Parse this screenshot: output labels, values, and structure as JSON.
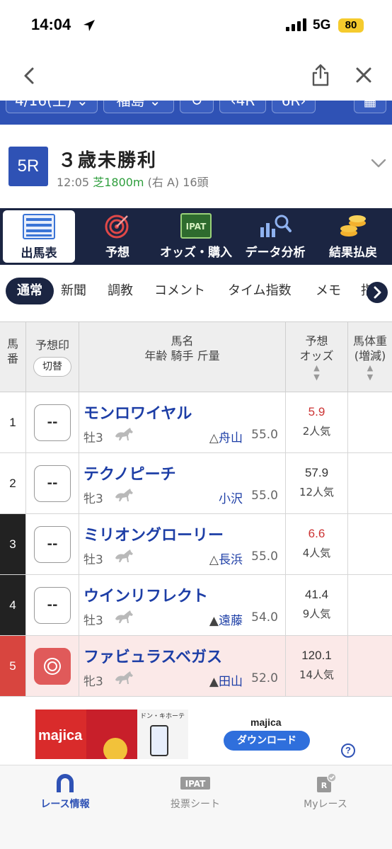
{
  "status_bar": {
    "time": "14:04",
    "network": "5G",
    "battery": "80"
  },
  "date_bar": {
    "date": "4/16(土)",
    "venue": "福島",
    "prev_race": "4R",
    "next_race": "6R"
  },
  "race": {
    "number": "5R",
    "name": "３歳未勝利",
    "time": "12:05",
    "course": "芝1800m",
    "course_detail": "(右 A) 16頭"
  },
  "menu": [
    {
      "label": "出馬表",
      "icon": "race-card-icon"
    },
    {
      "label": "予想",
      "icon": "target-icon"
    },
    {
      "label": "オッズ・購入",
      "icon": "ipat-icon"
    },
    {
      "label": "データ分析",
      "icon": "chart-search-icon"
    },
    {
      "label": "結果払戻",
      "icon": "coins-icon"
    }
  ],
  "sub_tabs": [
    "通常",
    "新聞",
    "調教",
    "コメント",
    "タイム指数",
    "メモ",
    "指"
  ],
  "table": {
    "header": {
      "num": [
        "馬",
        "番"
      ],
      "mark": "予想印",
      "switch": "切替",
      "name_line1": "馬名",
      "name_line2": "年齢 騎手 斤量",
      "odds_line1": "予想",
      "odds_line2": "オッズ",
      "body_line1": "馬体重",
      "body_line2": "(増減)"
    },
    "rows": [
      {
        "num": "1",
        "mark": "--",
        "name": "モンロワイヤル",
        "sex_age": "牡3",
        "jockey_mark": "△",
        "jockey": "舟山",
        "weight": "55.0",
        "odds": "5.9",
        "popularity": "2人気",
        "hot": true,
        "frame_color": "#ffffff",
        "num_color": "#222222"
      },
      {
        "num": "2",
        "mark": "--",
        "name": "テクノピーチ",
        "sex_age": "牝3",
        "jockey_mark": "",
        "jockey": "小沢",
        "weight": "55.0",
        "odds": "57.9",
        "popularity": "12人気",
        "hot": false,
        "frame_color": "#ffffff",
        "num_color": "#222222"
      },
      {
        "num": "3",
        "mark": "--",
        "name": "ミリオングローリー",
        "sex_age": "牡3",
        "jockey_mark": "△",
        "jockey": "長浜",
        "weight": "55.0",
        "odds": "6.6",
        "popularity": "4人気",
        "hot": true,
        "frame_color": "#222222",
        "num_color": "#ffffff"
      },
      {
        "num": "4",
        "mark": "--",
        "name": "ウインリフレクト",
        "sex_age": "牡3",
        "jockey_mark": "▲",
        "jockey": "遠藤",
        "weight": "54.0",
        "odds": "41.4",
        "popularity": "9人気",
        "hot": false,
        "frame_color": "#222222",
        "num_color": "#ffffff"
      },
      {
        "num": "5",
        "mark": "◎",
        "name": "ファビュラスベガス",
        "sex_age": "牝3",
        "jockey_mark": "▲",
        "jockey": "田山",
        "weight": "52.0",
        "odds": "120.1",
        "popularity": "14人気",
        "hot": false,
        "frame_color": "#d8453f",
        "num_color": "#ffffff"
      }
    ]
  },
  "ad": {
    "brand": "majica",
    "title": "majica",
    "button": "ダウンロード",
    "help": "?"
  },
  "tab_bar": [
    {
      "label": "レース情報",
      "icon": "horseshoe-icon"
    },
    {
      "label": "投票シート",
      "icon": "ipat-ticket-icon"
    },
    {
      "label": "Myレース",
      "icon": "my-race-icon"
    }
  ]
}
